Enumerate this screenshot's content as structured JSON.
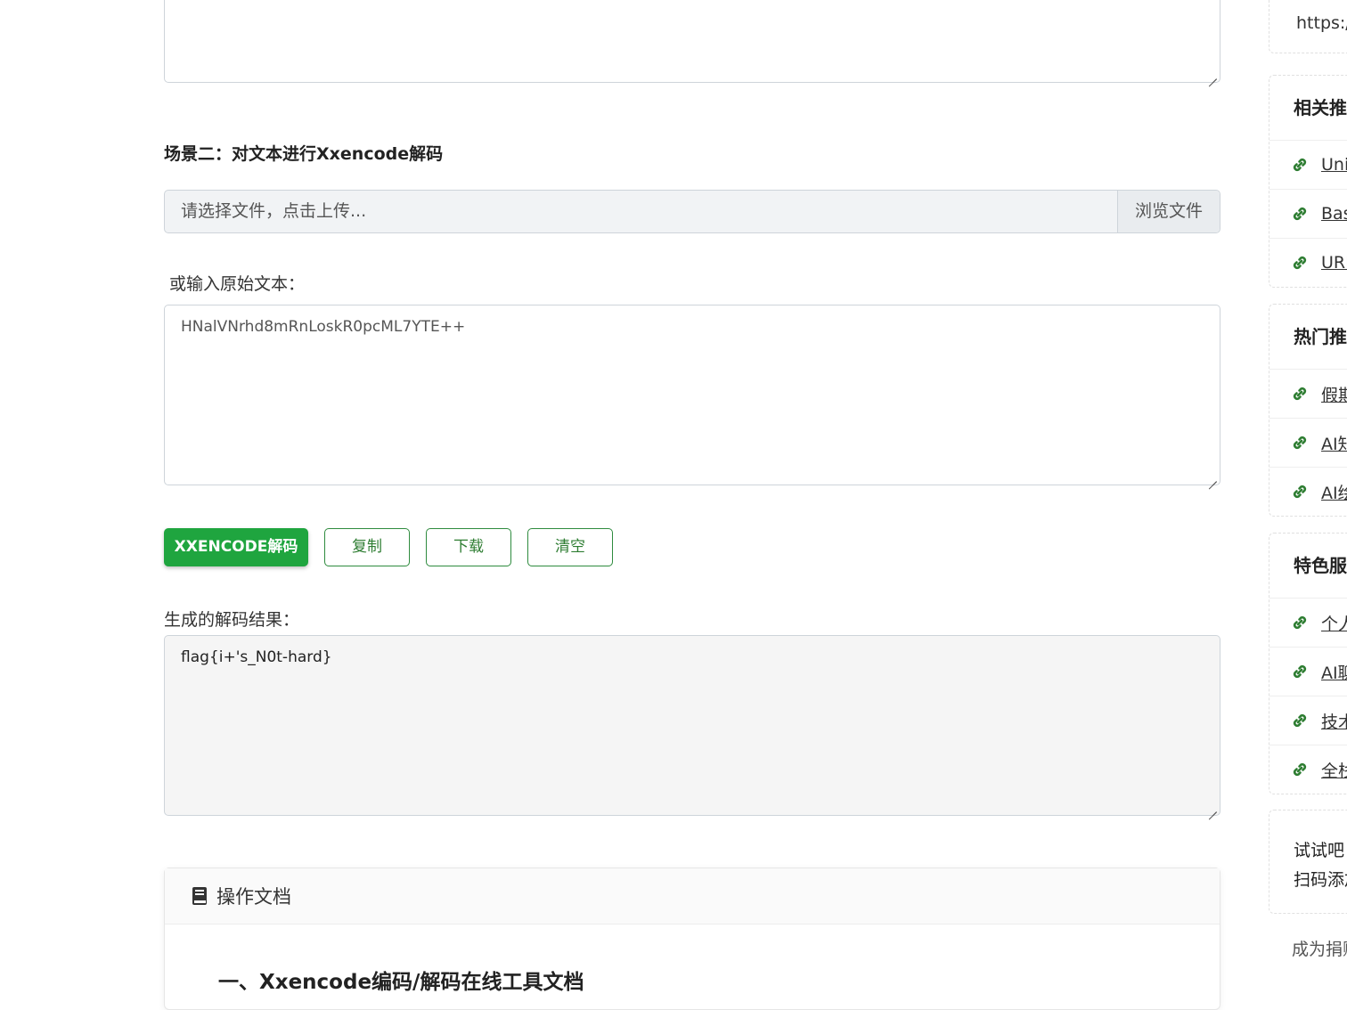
{
  "scenario2": {
    "heading": "场景二：对文本进行Xxencode解码",
    "upload_placeholder": "请选择文件，点击上传...",
    "browse_label": "浏览文件",
    "input_label": "或输入原始文本：",
    "input_value": "HNalVNrhd8mRnLoskR0pcML7YTE++",
    "buttons": {
      "decode": "XXENCODE解码",
      "copy": "复制",
      "download": "下载",
      "clear": "清空"
    },
    "result_label": "生成的解码结果：",
    "result_value": "flag{i+'s_N0t-hard}"
  },
  "docs": {
    "header": "操作文档",
    "heading": "一、Xxencode编码/解码在线工具文档"
  },
  "sidebar": {
    "top_text": "https:/",
    "related": {
      "title": "相关推荐",
      "items": [
        "Uni",
        "Bas",
        "URL"
      ]
    },
    "hot": {
      "title": "热门推荐",
      "items": [
        "假期",
        "AI知",
        "AI绘"
      ]
    },
    "featured": {
      "title": "特色服务",
      "items": [
        "个人",
        "AI聊",
        "技术",
        "全栈"
      ]
    },
    "promo": {
      "line1": "试试吧",
      "line2": "扫码添加"
    },
    "bottom_text": "成为捐赠"
  },
  "colors": {
    "primary": "#1fa53f",
    "link_icon": "#2e7d32"
  }
}
